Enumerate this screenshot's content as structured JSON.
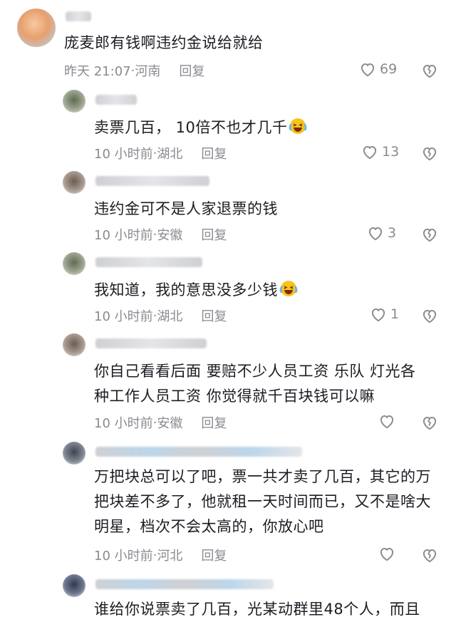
{
  "comments": [
    {
      "text": "庞麦郎有钱啊违约金说给就给",
      "time": "昨天 21:07",
      "location": "河南",
      "reply": "回复",
      "likes": "69"
    },
    {
      "text": "卖票几百， 10倍不也才几千",
      "time": "10 小时前",
      "location": "湖北",
      "reply": "回复",
      "likes": "13",
      "emoji": "laughing-crying-emoji"
    },
    {
      "text": "违约金可不是人家退票的钱",
      "time": "10 小时前",
      "location": "安徽",
      "reply": "回复",
      "likes": "3"
    },
    {
      "text": "我知道，我的意思没多少钱",
      "time": "10 小时前",
      "location": "湖北",
      "reply": "回复",
      "likes": "1",
      "emoji": "laughing-crying-emoji"
    },
    {
      "line1": "你自己看看后面  要赔不少人员工资  乐队  灯光各",
      "line2": "种工作人员工资  你觉得就千百块钱可以嘛",
      "time": "10 小时前",
      "location": "安徽",
      "reply": "回复",
      "likes": ""
    },
    {
      "line1": "万把块总可以了吧，票一共才卖了几百，其它的万",
      "line2": "把块差不多了，他就租一天时间而已，又不是啥大",
      "line3": "明星，档次不会太高的，你放心吧",
      "time": "10 小时前",
      "location": "河北",
      "reply": "回复",
      "likes": ""
    },
    {
      "text": "谁给你说票卖了几百，光某动群里48个人，而且"
    }
  ],
  "separator": " · ",
  "colors": {
    "text": "#1c1d24",
    "meta": "#8a8b91"
  }
}
